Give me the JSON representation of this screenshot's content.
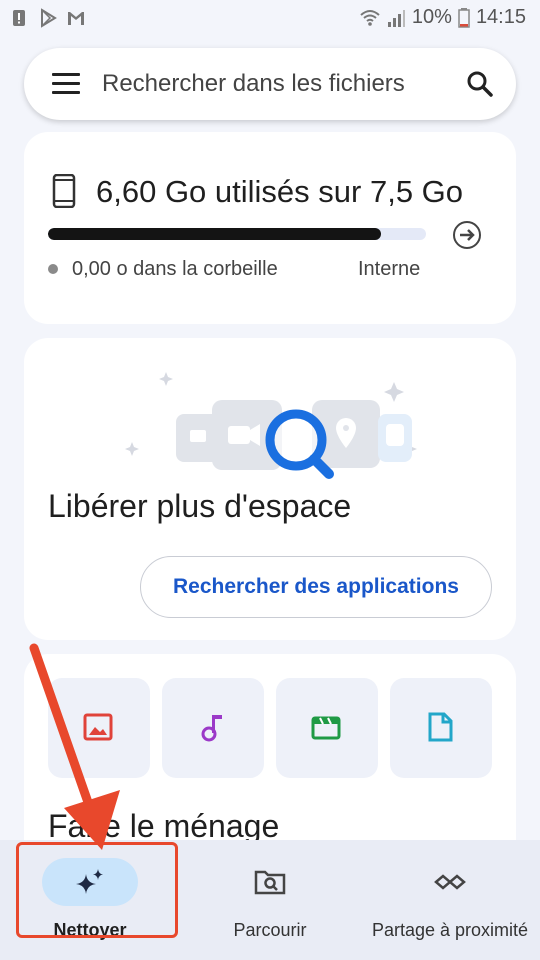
{
  "status_bar": {
    "battery": "10%",
    "time": "14:15",
    "icons": [
      "alert-icon",
      "play-store-icon",
      "gmail-icon",
      "wifi-icon",
      "signal-icon",
      "battery-icon"
    ]
  },
  "search": {
    "placeholder": "Rechercher dans les fichiers",
    "icons": [
      "menu-icon",
      "search-icon"
    ]
  },
  "storage": {
    "title": "6,60 Go utilisés sur 7,5 Go",
    "used_fraction": 0.88,
    "trash": "0,00 o dans la corbeille",
    "location": "Interne",
    "icons": [
      "phone-icon",
      "arrow-right-circle-icon"
    ]
  },
  "free_space": {
    "title": "Libérer plus d'espace",
    "button": "Rechercher des applications"
  },
  "cleanup": {
    "title": "Faire le ménage",
    "tiles": [
      {
        "icon": "image-icon",
        "color": "#e0433a"
      },
      {
        "icon": "music-icon",
        "color": "#9b39c8"
      },
      {
        "icon": "video-icon",
        "color": "#1f9a45"
      },
      {
        "icon": "document-icon",
        "color": "#22a6c9"
      }
    ]
  },
  "bottom_nav": {
    "items": [
      {
        "label": "Nettoyer",
        "icon": "sparkle-icon",
        "active": true
      },
      {
        "label": "Parcourir",
        "icon": "browse-folder-icon",
        "active": false
      },
      {
        "label": "Partage à proximité",
        "icon": "nearby-share-icon",
        "active": false
      }
    ]
  },
  "colors": {
    "accent_blue": "#1a57c9",
    "highlight_red": "#e8482c",
    "active_pill": "#c9e4fb"
  }
}
